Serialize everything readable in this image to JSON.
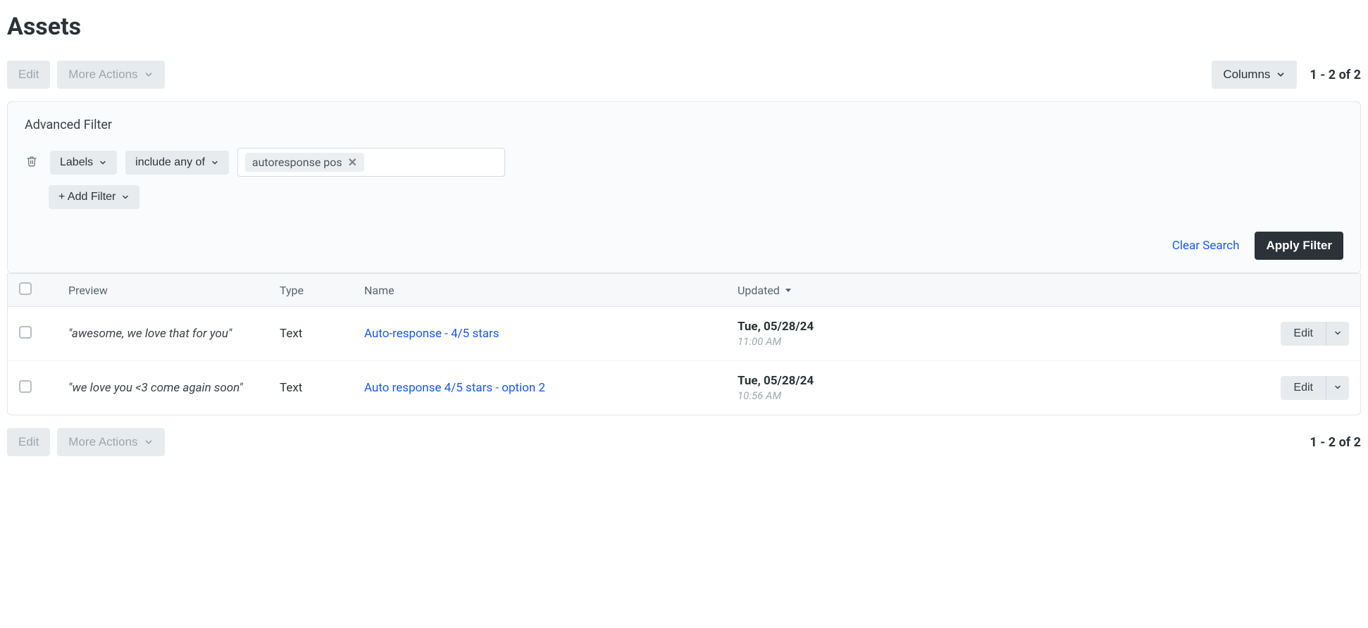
{
  "page": {
    "title": "Assets"
  },
  "toolbar": {
    "edit_label": "Edit",
    "more_actions_label": "More Actions",
    "columns_label": "Columns",
    "range_text": "1 - 2 of 2"
  },
  "filter": {
    "title": "Advanced Filter",
    "field": "Labels",
    "operator": "include any of",
    "tag": "autoresponse pos",
    "add_filter": "+ Add Filter",
    "clear": "Clear Search",
    "apply": "Apply Filter"
  },
  "table": {
    "headers": {
      "preview": "Preview",
      "type": "Type",
      "name": "Name",
      "updated": "Updated"
    },
    "rows": [
      {
        "preview": "\"awesome, we love that for you\"",
        "type": "Text",
        "name": "Auto-response - 4/5 stars",
        "date": "Tue, 05/28/24",
        "time": "11:00 AM"
      },
      {
        "preview": "\"we love you <3 come again soon\"",
        "type": "Text",
        "name": "Auto response 4/5 stars - option 2",
        "date": "Tue, 05/28/24",
        "time": "10:56 AM"
      }
    ],
    "row_action": "Edit"
  }
}
